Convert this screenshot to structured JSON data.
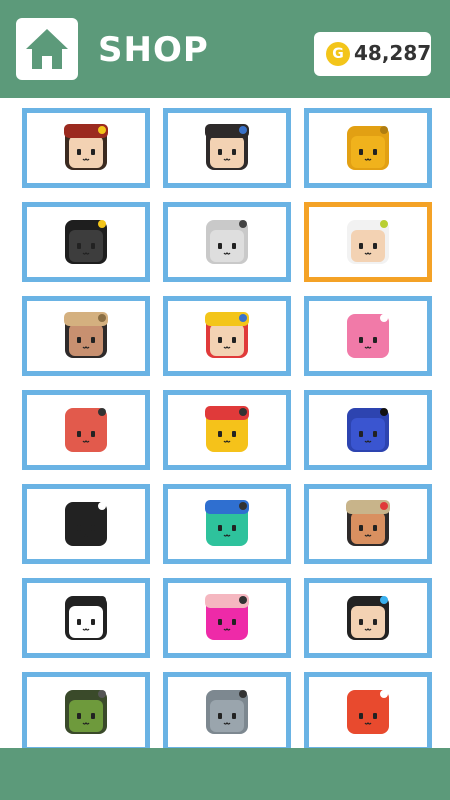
{
  "header": {
    "title": "SHOP",
    "coin_symbol": "G",
    "coin_balance": "48,287"
  },
  "colors": {
    "header_bg": "#5c9a7a",
    "cell_border": "#6ab3e4",
    "selected_border": "#f4a226",
    "coin": "#f3c51a"
  },
  "shop": {
    "selected_index": 5,
    "characters": [
      {
        "name": "pirate-captain",
        "skin": "#f3d2b3",
        "hair": "#3b2a20",
        "hat": "#9b2a1f",
        "accent": "#f3c51a"
      },
      {
        "name": "samurai",
        "skin": "#f3d2b3",
        "hair": "#2e2a2a",
        "hat": "#2e2a2a",
        "accent": "#3a72c8"
      },
      {
        "name": "lion",
        "skin": "#f0b21c",
        "hair": "#e2a013",
        "hat": null,
        "accent": "#b07d10"
      },
      {
        "name": "afro-star",
        "skin": "#3d3d3d",
        "hair": "#1e1e1e",
        "hat": null,
        "accent": "#f3c51a"
      },
      {
        "name": "white-dog",
        "skin": "#dedede",
        "hair": "#c9c9c9",
        "hat": null,
        "accent": "#444444"
      },
      {
        "name": "white-hair-elder",
        "skin": "#f3d2b3",
        "hair": "#f2f2f2",
        "hat": null,
        "accent": "#b9cf32"
      },
      {
        "name": "explorer",
        "skin": "#c89070",
        "hair": "#2e2a2a",
        "hat": "#d4b07f",
        "accent": "#8a6e44"
      },
      {
        "name": "clown",
        "skin": "#f3d2b3",
        "hair": "#e03a3a",
        "hat": "#f3c51a",
        "accent": "#3a72c8"
      },
      {
        "name": "pink-robot",
        "skin": "#f17aa8",
        "hair": "#f17aa8",
        "hat": null,
        "accent": "#ffffff"
      },
      {
        "name": "red-block",
        "skin": "#e25a4c",
        "hair": "#e25a4c",
        "hat": null,
        "accent": "#333333"
      },
      {
        "name": "yellow-bow",
        "skin": "#f5c21a",
        "hair": "#f5c21a",
        "hat": "#e03a3a",
        "accent": "#333333"
      },
      {
        "name": "blue-glasses",
        "skin": "#3a55d0",
        "hair": "#2d44b0",
        "hat": null,
        "accent": "#111111"
      },
      {
        "name": "black-cat",
        "skin": "#222222",
        "hair": "#222222",
        "hat": null,
        "accent": "#ffffff"
      },
      {
        "name": "cap-zombie",
        "skin": "#2ec29c",
        "hair": "#2ec29c",
        "hat": "#2f6fd0",
        "accent": "#333333"
      },
      {
        "name": "turban",
        "skin": "#d99060",
        "hair": "#2e2a2a",
        "hat": "#c8b48a",
        "accent": "#e03a3a"
      },
      {
        "name": "panda",
        "skin": "#ffffff",
        "hair": "#222222",
        "hat": null,
        "accent": "#222222"
      },
      {
        "name": "magenta-flower",
        "skin": "#ee2aa8",
        "hair": "#ee2aa8",
        "hat": "#f5b7c0",
        "accent": "#333333"
      },
      {
        "name": "blue-bun-girl",
        "skin": "#f3d2b3",
        "hair": "#222222",
        "hat": null,
        "accent": "#3ab0ee"
      },
      {
        "name": "frankenstein",
        "skin": "#6e9a3c",
        "hair": "#3a4a2a",
        "hat": null,
        "accent": "#555555"
      },
      {
        "name": "gray-robot",
        "skin": "#9aa5ad",
        "hair": "#7d8890",
        "hat": null,
        "accent": "#333333"
      },
      {
        "name": "red-hood",
        "skin": "#e84a2e",
        "hair": "#e84a2e",
        "hat": null,
        "accent": "#ffffff"
      }
    ]
  }
}
